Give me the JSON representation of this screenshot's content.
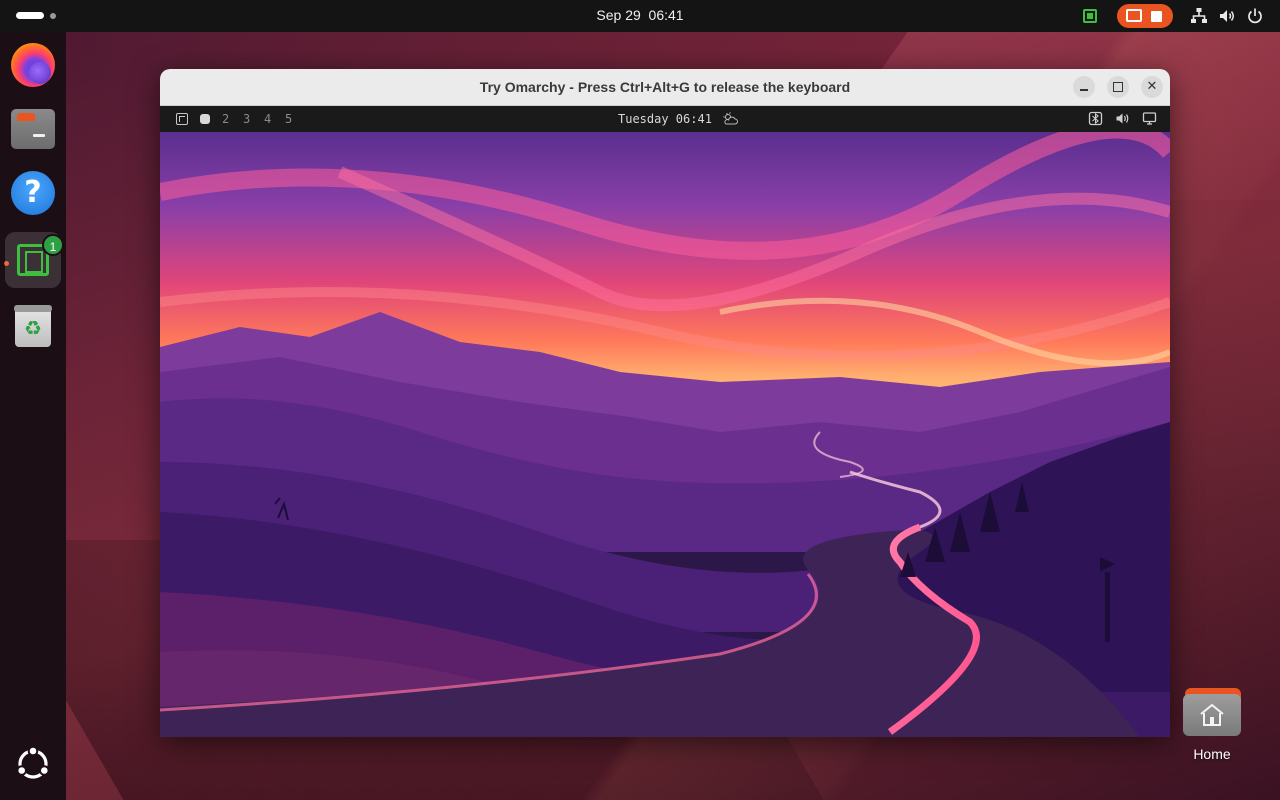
{
  "top_bar": {
    "date": "Sep 29",
    "time": "06:41"
  },
  "dock": {
    "items": [
      {
        "name": "Firefox",
        "icon": "firefox-icon"
      },
      {
        "name": "Files",
        "icon": "files-icon"
      },
      {
        "name": "Help",
        "icon": "help-icon",
        "glyph": "?"
      },
      {
        "name": "Terminal",
        "icon": "terminal-icon",
        "badge": "1",
        "active": true
      },
      {
        "name": "Trash",
        "icon": "trash-icon",
        "glyph": "♻"
      }
    ]
  },
  "window": {
    "title": "Try Omarchy - Press Ctrl+Alt+G to release the keyboard"
  },
  "guest": {
    "workspaces": [
      "2",
      "3",
      "4",
      "5"
    ],
    "clock": "Tuesday 06:41"
  },
  "desktop": {
    "home_label": "Home"
  },
  "colors": {
    "accent": "#e95420",
    "badge": "#2ea043",
    "indicator": "#3fbf3f"
  }
}
